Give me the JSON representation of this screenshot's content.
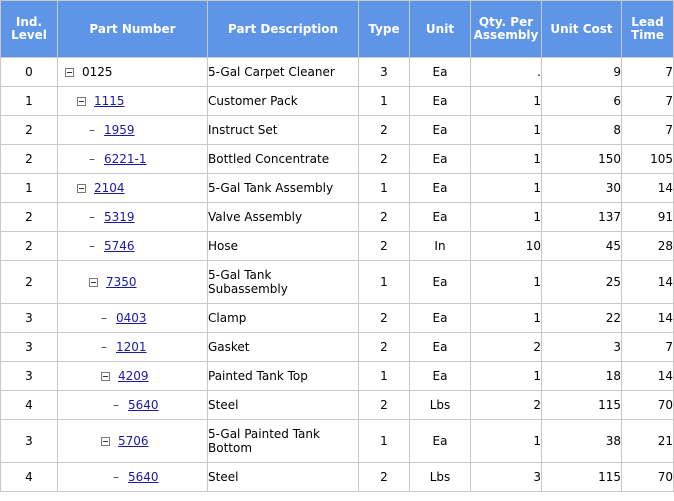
{
  "colors": {
    "header_bg": "#5f95e6",
    "header_text": "#ffffff",
    "link": "#1a1aa8",
    "grid": "#c8c8c8"
  },
  "columns": {
    "level": [
      "Ind.",
      "Level"
    ],
    "part": "Part Number",
    "desc": "Part Description",
    "type": "Type",
    "unit": "Unit",
    "qty": [
      "Qty. Per",
      "Assembly"
    ],
    "cost": "Unit Cost",
    "lead": [
      "Lead",
      "Time"
    ]
  },
  "rows": [
    {
      "level": "0",
      "part": "0125",
      "link": false,
      "node": "collapse",
      "desc": [
        "5-Gal Carpet Cleaner"
      ],
      "type": "3",
      "unit": "Ea",
      "qty": ".",
      "cost": "9",
      "lead": "7"
    },
    {
      "level": "1",
      "part": "1115",
      "link": true,
      "node": "collapse",
      "desc": [
        "Customer Pack"
      ],
      "type": "1",
      "unit": "Ea",
      "qty": "1",
      "cost": "6",
      "lead": "7"
    },
    {
      "level": "2",
      "part": "1959",
      "link": true,
      "node": "leaf",
      "desc": [
        "Instruct Set"
      ],
      "type": "2",
      "unit": "Ea",
      "qty": "1",
      "cost": "8",
      "lead": "7"
    },
    {
      "level": "2",
      "part": "6221-1",
      "link": true,
      "node": "leaf",
      "desc": [
        "Bottled Concentrate"
      ],
      "type": "2",
      "unit": "Ea",
      "qty": "1",
      "cost": "150",
      "lead": "105"
    },
    {
      "level": "1",
      "part": "2104",
      "link": true,
      "node": "collapse",
      "desc": [
        "5-Gal Tank Assembly"
      ],
      "type": "1",
      "unit": "Ea",
      "qty": "1",
      "cost": "30",
      "lead": "14"
    },
    {
      "level": "2",
      "part": "5319",
      "link": true,
      "node": "leaf",
      "desc": [
        "Valve Assembly"
      ],
      "type": "2",
      "unit": "Ea",
      "qty": "1",
      "cost": "137",
      "lead": "91"
    },
    {
      "level": "2",
      "part": "5746",
      "link": true,
      "node": "leaf",
      "desc": [
        "Hose"
      ],
      "type": "2",
      "unit": "In",
      "qty": "10",
      "cost": "45",
      "lead": "28"
    },
    {
      "level": "2",
      "part": "7350",
      "link": true,
      "node": "collapse",
      "desc": [
        "5-Gal Tank",
        "Subassembly"
      ],
      "type": "1",
      "unit": "Ea",
      "qty": "1",
      "cost": "25",
      "lead": "14"
    },
    {
      "level": "3",
      "part": "0403",
      "link": true,
      "node": "leaf",
      "desc": [
        "Clamp"
      ],
      "type": "2",
      "unit": "Ea",
      "qty": "1",
      "cost": "22",
      "lead": "14"
    },
    {
      "level": "3",
      "part": "1201",
      "link": true,
      "node": "leaf",
      "desc": [
        "Gasket"
      ],
      "type": "2",
      "unit": "Ea",
      "qty": "2",
      "cost": "3",
      "lead": "7"
    },
    {
      "level": "3",
      "part": "4209",
      "link": true,
      "node": "collapse",
      "desc": [
        "Painted Tank Top"
      ],
      "type": "1",
      "unit": "Ea",
      "qty": "1",
      "cost": "18",
      "lead": "14"
    },
    {
      "level": "4",
      "part": "5640",
      "link": true,
      "node": "leaf",
      "desc": [
        "Steel"
      ],
      "type": "2",
      "unit": "Lbs",
      "qty": "2",
      "cost": "115",
      "lead": "70"
    },
    {
      "level": "3",
      "part": "5706",
      "link": true,
      "node": "collapse",
      "desc": [
        "5-Gal Painted Tank",
        "Bottom"
      ],
      "type": "1",
      "unit": "Ea",
      "qty": "1",
      "cost": "38",
      "lead": "21"
    },
    {
      "level": "4",
      "part": "5640",
      "link": true,
      "node": "leaf",
      "desc": [
        "Steel"
      ],
      "type": "2",
      "unit": "Lbs",
      "qty": "3",
      "cost": "115",
      "lead": "70"
    }
  ]
}
